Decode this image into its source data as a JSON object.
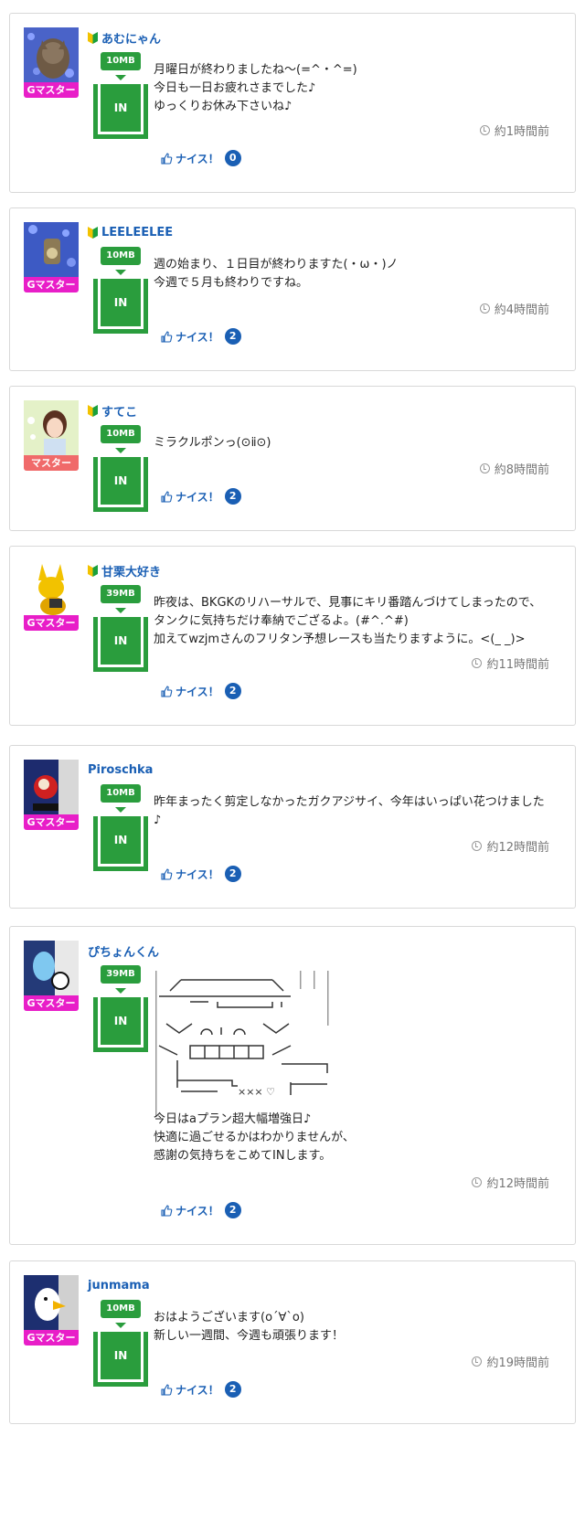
{
  "common": {
    "in_label": "IN",
    "nice_label": "ナイス！"
  },
  "posts": [
    {
      "user": "あむにゃん",
      "rank": "Gマスター",
      "rank_color": "#e81ec8",
      "size": "10MB",
      "message": "月曜日が終わりましたね〜(=^・^=)\n今日も一日お疲れさまでした♪\nゆっくりお休み下さいね♪",
      "time": "約1時間前",
      "nice_count": "0",
      "beginner": true
    },
    {
      "user": "LEELEELEE",
      "rank": "Gマスター",
      "rank_color": "#e81ec8",
      "size": "10MB",
      "message": "週の始まり、１日目が終わりますた(・ω・)ノ\n今週で５月も終わりですね。",
      "time": "約4時間前",
      "nice_count": "2",
      "beginner": true
    },
    {
      "user": "すてこ",
      "rank": "マスター",
      "rank_color": "#f06a6a",
      "size": "10MB",
      "message": "ミラクルポンっ(⊙ⅱ⊙)",
      "time": "約8時間前",
      "nice_count": "2",
      "beginner": true
    },
    {
      "user": "甘栗大好き",
      "rank": "Gマスター",
      "rank_color": "#e81ec8",
      "size": "39MB",
      "message": "昨夜は、BKGKのリハーサルで、見事にキリ番踏んづけてしまったので、タンクに気持ちだけ奉納でござるよ。(#^.^#)\n加えてwzjmさんのフリタン予想レースも当たりますように。<(_ _)>",
      "time": "約11時間前",
      "nice_count": "2",
      "beginner": true
    },
    {
      "user": "Piroschka",
      "rank": "Gマスター",
      "rank_color": "#e81ec8",
      "size": "10MB",
      "message": "昨年まったく剪定しなかったガクアジサイ、今年はいっぱい花つけました♪",
      "time": "約12時間前",
      "nice_count": "2",
      "beginner": false
    },
    {
      "user": "ぴちょんくん",
      "rank": "Gマスター",
      "rank_color": "#e81ec8",
      "size": "39MB",
      "message": "今日はaプラン超大幅増強日♪\n快適に過ごせるかはわかりませんが、\n感謝の気持ちをこめてINします。",
      "time": "約12時間前",
      "nice_count": "2",
      "beginner": false,
      "ascii_art_marks": "×××  ♡"
    },
    {
      "user": "junmama",
      "rank": "Gマスター",
      "rank_color": "#e81ec8",
      "size": "10MB",
      "message": "おはようございます(o´∀`o)\n新しい一週間、今週も頑張ります！",
      "time": "約19時間前",
      "nice_count": "2",
      "beginner": false
    }
  ]
}
